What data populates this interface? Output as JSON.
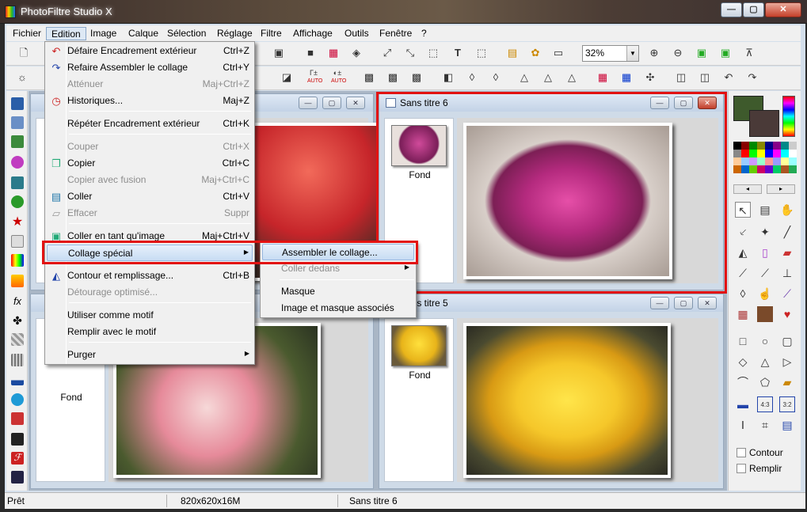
{
  "window": {
    "title": "PhotoFiltre Studio X"
  },
  "menubar": [
    "Fichier",
    "Edition",
    "Image",
    "Calque",
    "Sélection",
    "Réglage",
    "Filtre",
    "Affichage",
    "Outils",
    "Fenêtre",
    "?"
  ],
  "toolbar": {
    "zoom": "32%",
    "auto_label": "AUTO"
  },
  "edit_menu": [
    {
      "label": "Défaire Encadrement extérieur",
      "shortcut": "Ctrl+Z",
      "disabled": false,
      "icon": "undo-icon"
    },
    {
      "label": "Refaire Assembler le collage",
      "shortcut": "Ctrl+Y",
      "disabled": false,
      "icon": "redo-icon"
    },
    {
      "label": "Atténuer",
      "shortcut": "Maj+Ctrl+Z",
      "disabled": true,
      "icon": ""
    },
    {
      "label": "Historiques...",
      "shortcut": "Maj+Z",
      "disabled": false,
      "icon": "history-icon"
    },
    {
      "label": "Répéter Encadrement extérieur",
      "shortcut": "Ctrl+K",
      "disabled": false,
      "icon": ""
    },
    {
      "label": "Couper",
      "shortcut": "Ctrl+X",
      "disabled": true,
      "icon": ""
    },
    {
      "label": "Copier",
      "shortcut": "Ctrl+C",
      "disabled": false,
      "icon": "copy-icon"
    },
    {
      "label": "Copier avec fusion",
      "shortcut": "Maj+Ctrl+C",
      "disabled": true,
      "icon": ""
    },
    {
      "label": "Coller",
      "shortcut": "Ctrl+V",
      "disabled": false,
      "icon": "paste-icon"
    },
    {
      "label": "Effacer",
      "shortcut": "Suppr",
      "disabled": true,
      "icon": "eraser-icon"
    },
    {
      "label": "Coller en tant qu'image",
      "shortcut": "Maj+Ctrl+V",
      "disabled": false,
      "icon": "paste-image-icon"
    },
    {
      "label": "Collage spécial",
      "shortcut": "",
      "disabled": false,
      "icon": "",
      "submenu": true
    },
    {
      "label": "Contour et remplissage...",
      "shortcut": "Ctrl+B",
      "disabled": false,
      "icon": "bucket-icon"
    },
    {
      "label": "Détourage optimisé...",
      "shortcut": "",
      "disabled": true,
      "icon": ""
    },
    {
      "label": "Utiliser comme motif",
      "shortcut": "",
      "disabled": false,
      "icon": ""
    },
    {
      "label": "Remplir avec le motif",
      "shortcut": "",
      "disabled": false,
      "icon": ""
    },
    {
      "label": "Purger",
      "shortcut": "",
      "disabled": false,
      "icon": "",
      "submenu": true
    }
  ],
  "paste_submenu": [
    {
      "label": "Assembler le collage...",
      "disabled": false
    },
    {
      "label": "Coller dedans",
      "disabled": true,
      "submenu": true
    },
    {
      "label": "Masque",
      "disabled": false
    },
    {
      "label": "Image et masque associés",
      "disabled": false
    }
  ],
  "documents": [
    {
      "title": "Sans titre 6",
      "layer": "Fond"
    },
    {
      "title": "Sans titre 5",
      "layer": "Fond"
    },
    {
      "title": "",
      "layer": "Fond"
    }
  ],
  "right_panel": {
    "outline": "Contour",
    "fill": "Remplir"
  },
  "status": {
    "state": "Prêt",
    "size": "820x620x16M",
    "doc": "Sans titre 6"
  },
  "colors": {
    "foreground": "#3e5a2c",
    "background": "#4a3a38",
    "highlight": "#e21212"
  }
}
